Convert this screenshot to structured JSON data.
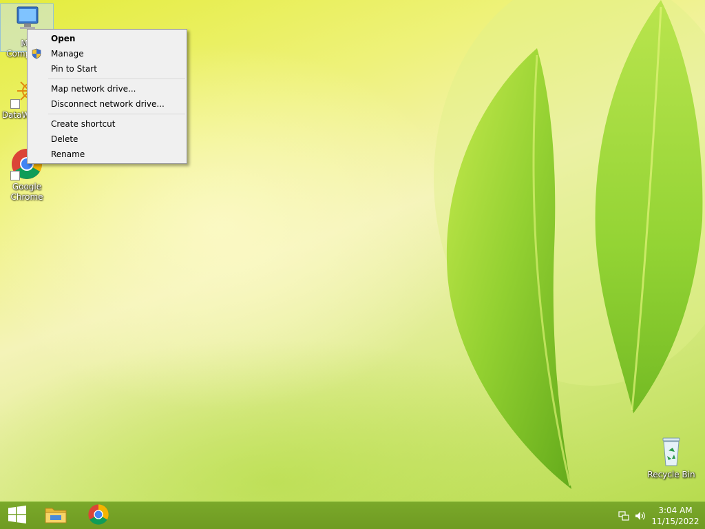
{
  "desktop": {
    "icons": [
      {
        "label": "My Computer",
        "icon": "computer-icon"
      },
      {
        "label": "DataWarrior",
        "icon": "datawarrior-icon"
      },
      {
        "label": "Google Chrome",
        "icon": "chrome-icon"
      },
      {
        "label": "Recycle Bin",
        "icon": "recycle-bin-icon"
      }
    ]
  },
  "context_menu": {
    "items": [
      {
        "label": "Open",
        "bold": true
      },
      {
        "label": "Manage",
        "icon": "uac-shield-icon"
      },
      {
        "label": "Pin to Start"
      },
      {
        "label": "Map network drive..."
      },
      {
        "label": "Disconnect network drive..."
      },
      {
        "label": "Create shortcut"
      },
      {
        "label": "Delete"
      },
      {
        "label": "Rename"
      }
    ]
  },
  "taskbar": {
    "start_icon": "windows-logo-icon",
    "pinned": [
      "file-explorer-icon",
      "chrome-icon"
    ],
    "tray": [
      "network-icon",
      "volume-icon"
    ],
    "clock": {
      "time": "3:04 AM",
      "date": "11/15/2022"
    }
  },
  "colors": {
    "taskbar": "#7aa82a",
    "menu_bg": "#f0f0f0",
    "wallpaper_leaf": "#8ccc2a"
  }
}
